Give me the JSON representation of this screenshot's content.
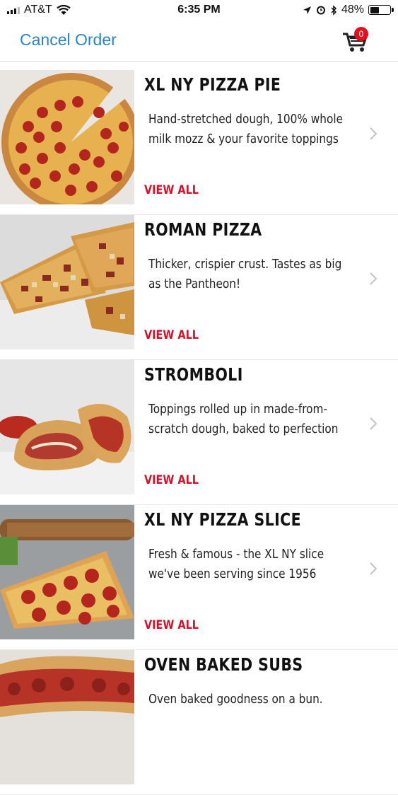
{
  "status_bar": {
    "carrier": "AT&T",
    "time": "6:35 PM",
    "battery": "48%",
    "battery_level": 0.48,
    "icons": [
      "signal-icon",
      "wifi-icon",
      "location-icon",
      "alarm-icon",
      "bluetooth-icon",
      "battery-icon"
    ]
  },
  "nav": {
    "cancel_label": "Cancel Order",
    "cart_count": "0",
    "cart_icon": "cart-icon"
  },
  "colors": {
    "link_blue": "#2a85c8",
    "accent_red": "#d3122a",
    "badge_red": "#e0121e"
  },
  "menu": {
    "items": [
      {
        "title": "XL NY PIZZA PIE",
        "desc_line1": "Hand-stretched dough, 100% whole",
        "desc_line2": "milk mozz & your favorite toppings",
        "view_all": "VIEW ALL"
      },
      {
        "title": "ROMAN PIZZA",
        "desc_line1": "Thicker, crispier crust.  Tastes as big",
        "desc_line2": "as the Pantheon!",
        "view_all": "VIEW ALL"
      },
      {
        "title": "STROMBOLI",
        "desc_line1": "Toppings rolled up in made-from-",
        "desc_line2": "scratch dough, baked to perfection",
        "view_all": "VIEW ALL"
      },
      {
        "title": "XL NY PIZZA SLICE",
        "desc_line1": "Fresh & famous - the XL NY slice",
        "desc_line2": "we've been serving since 1956",
        "view_all": "VIEW ALL"
      },
      {
        "title": "OVEN BAKED SUBS",
        "desc_line1": "Oven baked goodness on a bun.",
        "desc_line2": "",
        "view_all": ""
      }
    ]
  }
}
